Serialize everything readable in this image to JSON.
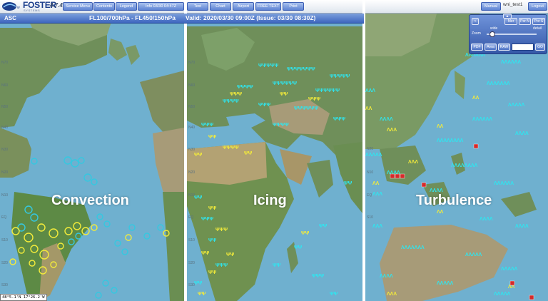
{
  "app": {
    "name": "FOSTER",
    "subtitle": "SYSTEMS",
    "version": "4.7.4"
  },
  "toolbar": {
    "left_buttons": [
      "Service Menu",
      "Contents",
      "Legend",
      "Info 03/30 04:47Z"
    ],
    "mid_buttons": [
      "Text",
      "Chart",
      "Airport",
      "FREE TEXT",
      "Print"
    ],
    "manual": "Manual",
    "user": "wni_test1",
    "logout": "Logout"
  },
  "infobar": {
    "region": "ASC",
    "flight_levels": "FL100/700hPa - FL450/150hPa",
    "valid": "Valid: 2020/03/30 09:00Z (Issue: 03/30 08:30Z)"
  },
  "panels": {
    "convection": "Convection",
    "icing": "Icing",
    "turbulence": "Turbulence"
  },
  "latitude_labels": {
    "left": [
      "N70",
      "N60",
      "N50",
      "N40",
      "N30",
      "N20",
      "N10",
      "EQ",
      "S10",
      "S20",
      "S30"
    ],
    "mid": [
      "N70",
      "N60",
      "N50",
      "N40",
      "N30",
      "N20",
      "N10",
      "EQ",
      "S10",
      "S20",
      "S30"
    ],
    "right": [
      "N20",
      "N10",
      "EQ",
      "S10"
    ]
  },
  "coordinates": "48°5.1'N 17°26.2'W",
  "map_controls": {
    "scroll_up": "▲",
    "buttons_row1": [
      "<",
      "Mer",
      "Por N",
      "Por S"
    ],
    "zoom_label": "Zoom",
    "wide_label": "wide",
    "detail_label": "detail",
    "zoom_level": 0.1,
    "buttons_row3": [
      "PDF",
      "Area",
      "RAW"
    ],
    "go": "GO",
    "search_value": ""
  },
  "colors": {
    "ocean": "#6fb0cf",
    "land": "#6f8f5a",
    "desert": "#a79b78",
    "hazard_light": "#2ee6f0",
    "hazard_moderate": "#f4ec3a",
    "hazard_severe": "#d62a2a",
    "toolbar_blue": "#4f77c8"
  }
}
